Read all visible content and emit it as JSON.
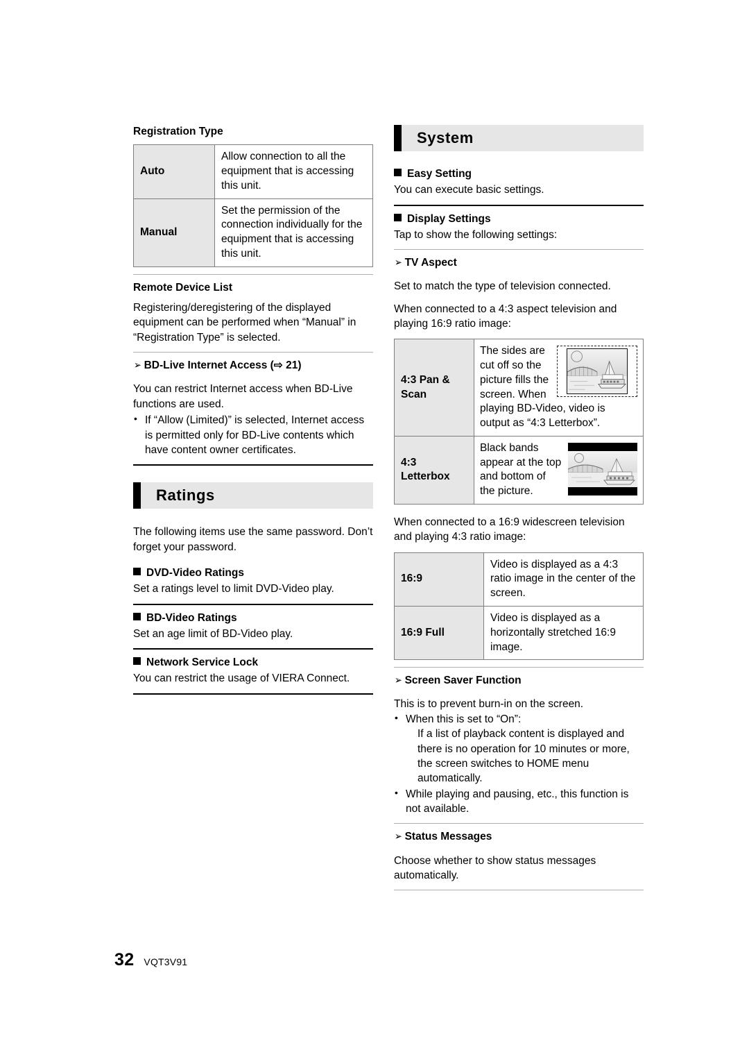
{
  "page": {
    "number": "32",
    "doc_code": "VQT3V91"
  },
  "left_column": {
    "registration": {
      "heading": "Registration Type",
      "table": {
        "rows": [
          {
            "label": "Auto",
            "desc": "Allow connection to all the equipment that is accessing this unit."
          },
          {
            "label": "Manual",
            "desc": "Set the permission of the connection individually for the equipment that is accessing this unit."
          }
        ]
      }
    },
    "remote_device_list": {
      "heading": "Remote Device List",
      "body": "Registering/deregistering of the displayed equipment can be performed when “Manual” in “Registration Type” is selected."
    },
    "bd_live": {
      "arrow": "➢",
      "heading": "BD-Live Internet Access (⇨ 21)",
      "body": "You can restrict Internet access when BD-Live functions are used.",
      "bullets": [
        "If “Allow (Limited)” is selected, Internet access is permitted only for BD-Live contents which have content owner certificates."
      ]
    },
    "ratings_section": {
      "title": "Ratings",
      "intro": "The following items use the same password. Don’t forget your password.",
      "items": [
        {
          "heading": "DVD-Video Ratings",
          "body": "Set a ratings level to limit DVD-Video play."
        },
        {
          "heading": "BD-Video Ratings",
          "body": "Set an age limit of BD-Video play."
        },
        {
          "heading": "Network Service Lock",
          "body": "You can restrict the usage of VIERA Connect."
        }
      ]
    }
  },
  "right_column": {
    "system_section": {
      "title": "System",
      "easy_setting": {
        "heading": "Easy Setting",
        "body": "You can execute basic settings."
      },
      "display_settings": {
        "heading": "Display Settings",
        "body": "Tap to show the following settings:"
      },
      "tv_aspect": {
        "arrow": "➢",
        "heading": "TV Aspect",
        "body1": "Set to match the type of television connected.",
        "body2": "When connected to a 4:3 aspect television and playing 16:9 ratio image:",
        "table_43": {
          "rows": [
            {
              "label": "4:3 Pan & Scan",
              "desc": "The sides are cut off so the picture fills the screen. When playing BD-Video, video is output as “4:3 Letterbox”.",
              "illustration": "pan-scan-illustration"
            },
            {
              "label": "4:3 Letterbox",
              "desc": "Black bands appear at the top and bottom of the picture.",
              "illustration": "letterbox-illustration"
            }
          ]
        },
        "body3": "When connected to a 16:9 widescreen television and playing 4:3 ratio image:",
        "table_169": {
          "rows": [
            {
              "label": "16:9",
              "desc": "Video is displayed as a 4:3 ratio image in the center of the screen."
            },
            {
              "label": "16:9 Full",
              "desc": "Video is displayed as a horizontally stretched 16:9 image."
            }
          ]
        }
      },
      "screen_saver": {
        "arrow": "➢",
        "heading": "Screen Saver Function",
        "body": "This is to prevent burn-in on the screen.",
        "bullets": [
          {
            "text": "When this is set to “On”:",
            "sub": "If a list of playback content is displayed and there is no operation for 10 minutes or more, the screen switches to HOME menu automatically."
          },
          {
            "text": "While playing and pausing, etc., this function is not available.",
            "sub": ""
          }
        ]
      },
      "status_messages": {
        "arrow": "➢",
        "heading": "Status Messages",
        "body": "Choose whether to show status messages automatically."
      }
    }
  },
  "colors": {
    "banner_bg": "#e6e6e6",
    "banner_tab": "#000000",
    "table_label_bg": "#e6e6e6",
    "table_border": "#7d7d7d",
    "rule": "#000000"
  }
}
